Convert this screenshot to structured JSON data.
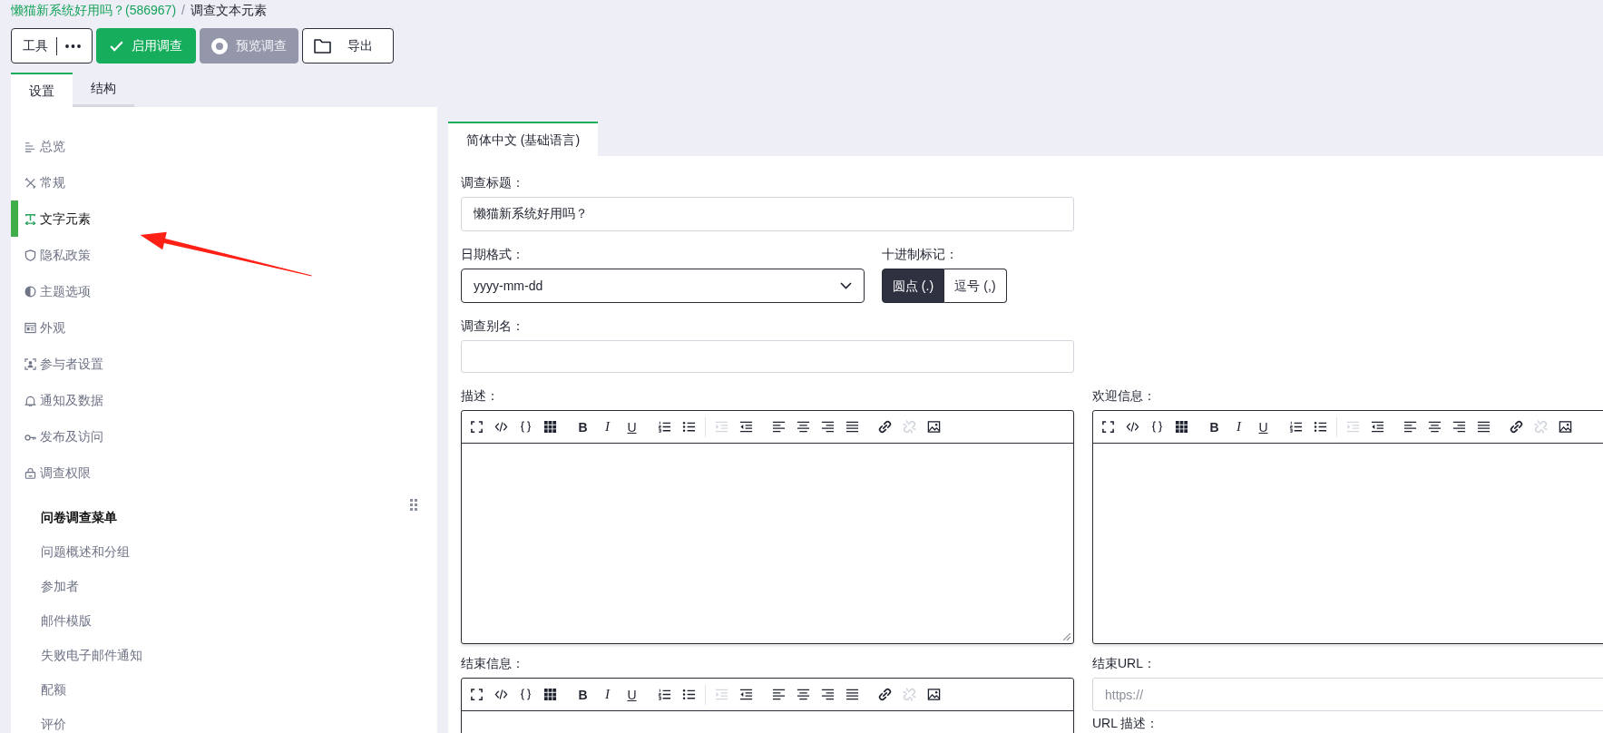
{
  "breadcrumb": {
    "link": "懒猫新系统好用吗？(586967)",
    "separator": "/",
    "current": "调查文本元素"
  },
  "toolbar": [
    {
      "kind": "menu",
      "label": "工具"
    },
    {
      "kind": "success",
      "label": "启用调查"
    },
    {
      "kind": "secondary",
      "label": "预览调查"
    },
    {
      "kind": "outline",
      "label": "导出"
    }
  ],
  "tabs": [
    {
      "label": "设置",
      "selected": true
    },
    {
      "label": "结构",
      "selected": false
    }
  ],
  "sidebar": {
    "items": [
      {
        "label": "总览",
        "selected": false
      },
      {
        "label": "常规",
        "selected": false
      },
      {
        "label": "文字元素",
        "selected": true
      },
      {
        "label": "隐私政策",
        "selected": false
      },
      {
        "label": "主题选项",
        "selected": false
      },
      {
        "label": "外观",
        "selected": false
      },
      {
        "label": "参与者设置",
        "selected": false
      },
      {
        "label": "通知及数据",
        "selected": false
      },
      {
        "label": "发布及访问",
        "selected": false
      },
      {
        "label": "调查权限",
        "selected": false
      }
    ],
    "menu": {
      "title": "问卷调查菜单",
      "items": [
        {
          "label": "问题概述和分组",
          "selected": false
        },
        {
          "label": "参加者",
          "selected": false
        },
        {
          "label": "邮件模版",
          "selected": false
        },
        {
          "label": "失败电子邮件通知",
          "selected": false
        },
        {
          "label": "配额",
          "selected": false
        },
        {
          "label": "评价",
          "selected": false
        }
      ]
    }
  },
  "language_tabs": [
    {
      "label": "简体中文 (基础语言)",
      "selected": true
    }
  ],
  "form": {
    "title": {
      "label": "调查标题：",
      "value": "懒猫新系统好用吗？"
    },
    "date_format": {
      "label": "日期格式：",
      "value": "yyyy-mm-dd"
    },
    "decimal_mark": {
      "label": "十进制标记：",
      "options": [
        {
          "label": "圆点 (.)",
          "selected": true
        },
        {
          "label": "逗号 (,)",
          "selected": false
        }
      ]
    },
    "alias": {
      "label": "调查别名："
    },
    "description": {
      "label": "描述：",
      "resize_grip": true,
      "toolbar": [
        {
          "kind": "buttons",
          "buttons": [
            {
              "kind": "fullscreen",
              "disabled": false
            },
            {
              "kind": "code",
              "disabled": false
            },
            {
              "kind": "braces",
              "disabled": false
            },
            {
              "kind": "grid",
              "disabled": false
            }
          ]
        },
        {
          "kind": "buttons",
          "buttons": [
            {
              "kind": "bold",
              "label": "B",
              "disabled": false
            },
            {
              "kind": "italic",
              "label": "I",
              "disabled": false
            },
            {
              "kind": "underline",
              "label": "U",
              "disabled": false
            }
          ]
        },
        {
          "kind": "buttons",
          "buttons": [
            {
              "kind": "ordered",
              "disabled": false
            },
            {
              "kind": "bullets",
              "disabled": false
            }
          ]
        },
        {
          "kind": "divider"
        },
        {
          "kind": "buttons",
          "buttons": [
            {
              "kind": "indent",
              "disabled": true
            },
            {
              "kind": "outdent",
              "disabled": false
            }
          ]
        },
        {
          "kind": "buttons",
          "buttons": [
            {
              "kind": "left",
              "disabled": false
            },
            {
              "kind": "center",
              "disabled": false
            },
            {
              "kind": "right",
              "disabled": false
            },
            {
              "kind": "justify",
              "disabled": false
            }
          ]
        },
        {
          "kind": "buttons",
          "buttons": [
            {
              "kind": "link",
              "disabled": false
            },
            {
              "kind": "unlink",
              "disabled": true
            },
            {
              "kind": "image",
              "disabled": false
            }
          ]
        }
      ]
    },
    "welcome": {
      "label": "欢迎信息：",
      "toolbar": [
        {
          "kind": "buttons",
          "buttons": [
            {
              "kind": "fullscreen",
              "disabled": false
            },
            {
              "kind": "code",
              "disabled": false
            },
            {
              "kind": "braces",
              "disabled": false
            },
            {
              "kind": "grid",
              "disabled": false
            }
          ]
        },
        {
          "kind": "buttons",
          "buttons": [
            {
              "kind": "bold",
              "label": "B",
              "disabled": false
            },
            {
              "kind": "italic",
              "label": "I",
              "disabled": false
            },
            {
              "kind": "underline",
              "label": "U",
              "disabled": false
            }
          ]
        },
        {
          "kind": "buttons",
          "buttons": [
            {
              "kind": "ordered",
              "disabled": false
            },
            {
              "kind": "bullets",
              "disabled": false
            }
          ]
        },
        {
          "kind": "divider"
        },
        {
          "kind": "buttons",
          "buttons": [
            {
              "kind": "indent",
              "disabled": true
            },
            {
              "kind": "outdent",
              "disabled": false
            }
          ]
        },
        {
          "kind": "buttons",
          "buttons": [
            {
              "kind": "left",
              "disabled": false
            },
            {
              "kind": "center",
              "disabled": false
            },
            {
              "kind": "right",
              "disabled": false
            },
            {
              "kind": "justify",
              "disabled": false
            }
          ]
        },
        {
          "kind": "buttons",
          "buttons": [
            {
              "kind": "link",
              "disabled": false
            },
            {
              "kind": "unlink",
              "disabled": true
            },
            {
              "kind": "image",
              "disabled": false
            }
          ]
        }
      ]
    },
    "end_message": {
      "label": "结束信息：",
      "toolbar": [
        {
          "kind": "buttons",
          "buttons": [
            {
              "kind": "fullscreen",
              "disabled": false
            },
            {
              "kind": "code",
              "disabled": false
            },
            {
              "kind": "braces",
              "disabled": false
            },
            {
              "kind": "grid",
              "disabled": false
            }
          ]
        },
        {
          "kind": "buttons",
          "buttons": [
            {
              "kind": "bold",
              "label": "B",
              "disabled": false
            },
            {
              "kind": "italic",
              "label": "I",
              "disabled": false
            },
            {
              "kind": "underline",
              "label": "U",
              "disabled": false
            }
          ]
        },
        {
          "kind": "buttons",
          "buttons": [
            {
              "kind": "ordered",
              "disabled": false
            },
            {
              "kind": "bullets",
              "disabled": false
            }
          ]
        },
        {
          "kind": "divider"
        },
        {
          "kind": "buttons",
          "buttons": [
            {
              "kind": "indent",
              "disabled": true
            },
            {
              "kind": "outdent",
              "disabled": false
            }
          ]
        },
        {
          "kind": "buttons",
          "buttons": [
            {
              "kind": "left",
              "disabled": false
            },
            {
              "kind": "center",
              "disabled": false
            },
            {
              "kind": "right",
              "disabled": false
            },
            {
              "kind": "justify",
              "disabled": false
            }
          ]
        },
        {
          "kind": "buttons",
          "buttons": [
            {
              "kind": "link",
              "disabled": false
            },
            {
              "kind": "unlink",
              "disabled": true
            },
            {
              "kind": "image",
              "disabled": false
            }
          ]
        }
      ]
    },
    "end_url": {
      "label": "结束URL：",
      "placeholder": "https://"
    },
    "url_description": {
      "label": "URL 描述："
    }
  }
}
